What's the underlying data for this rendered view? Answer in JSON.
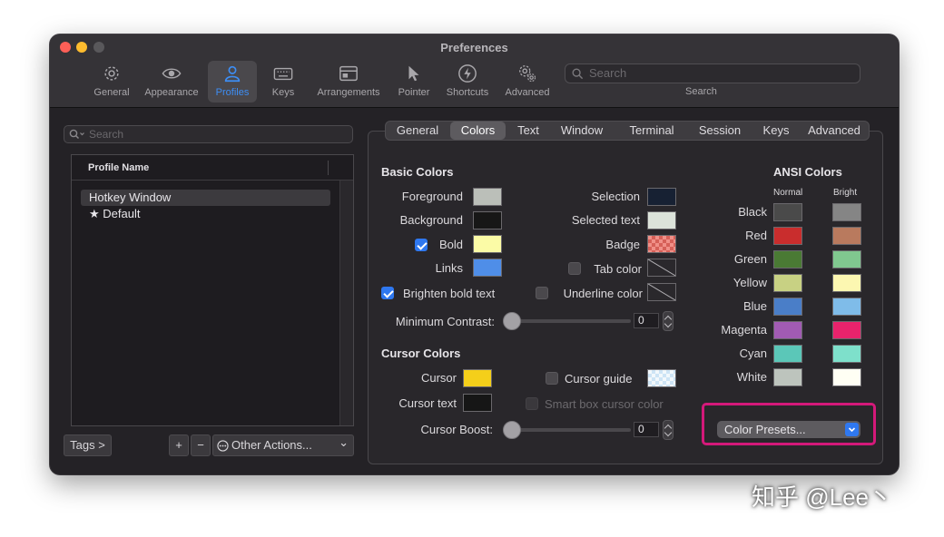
{
  "window": {
    "title": "Preferences"
  },
  "toolbar": {
    "items": [
      {
        "label": "General",
        "icon": "gear-icon"
      },
      {
        "label": "Appearance",
        "icon": "eye-icon"
      },
      {
        "label": "Profiles",
        "icon": "person-icon",
        "active": true
      },
      {
        "label": "Keys",
        "icon": "keyboard-icon"
      },
      {
        "label": "Arrangements",
        "icon": "window-icon"
      },
      {
        "label": "Pointer",
        "icon": "cursor-icon"
      },
      {
        "label": "Shortcuts",
        "icon": "lightning-icon"
      },
      {
        "label": "Advanced",
        "icon": "gears-icon"
      }
    ],
    "search_placeholder": "Search",
    "search_label": "Search"
  },
  "profiles": {
    "search_placeholder": "Search",
    "column_header": "Profile Name",
    "rows": [
      {
        "name": "Hotkey Window",
        "selected": true
      },
      {
        "name": "★ Default",
        "selected": false
      }
    ],
    "tags_button": "Tags >",
    "add_button": "+",
    "remove_button": "−",
    "other_actions": "Other Actions...",
    "other_actions_chevron": "⌄"
  },
  "tabs": [
    "General",
    "Colors",
    "Text",
    "Window",
    "Terminal",
    "Session",
    "Keys",
    "Advanced"
  ],
  "active_tab": "Colors",
  "basic_colors": {
    "heading": "Basic Colors",
    "foreground": {
      "label": "Foreground",
      "color": "#bbbfb9"
    },
    "background": {
      "label": "Background",
      "color": "#171717"
    },
    "bold": {
      "label": "Bold",
      "checked": true,
      "color": "#fbfba6"
    },
    "links": {
      "label": "Links",
      "color": "#4f8ee8"
    },
    "brighten_bold": {
      "label": "Brighten bold text",
      "checked": true
    },
    "selection": {
      "label": "Selection",
      "color": "#172133"
    },
    "selected_text": {
      "label": "Selected text",
      "color": "#dce3da"
    },
    "badge": {
      "label": "Badge",
      "color": "#e4736c"
    },
    "tab_color": {
      "label": "Tab color",
      "checked": false
    },
    "underline_color": {
      "label": "Underline color",
      "checked": false
    },
    "min_contrast": {
      "label": "Minimum Contrast:",
      "value": "0"
    }
  },
  "cursor_colors": {
    "heading": "Cursor Colors",
    "cursor": {
      "label": "Cursor",
      "color": "#f4cf1a"
    },
    "cursor_text": {
      "label": "Cursor text",
      "color": "#161616"
    },
    "cursor_guide": {
      "label": "Cursor guide",
      "checked": false
    },
    "smart_box": {
      "label": "Smart box cursor color",
      "checked": false,
      "disabled": true
    },
    "cursor_boost": {
      "label": "Cursor Boost:",
      "value": "0"
    }
  },
  "ansi": {
    "heading": "ANSI Colors",
    "normal_header": "Normal",
    "bright_header": "Bright",
    "rows": [
      {
        "name": "Black",
        "normal": "#4a4a4a",
        "bright": "#858585"
      },
      {
        "name": "Red",
        "normal": "#c92d2d",
        "bright": "#b97a5e"
      },
      {
        "name": "Green",
        "normal": "#4a7a34",
        "bright": "#80c88f"
      },
      {
        "name": "Yellow",
        "normal": "#c8d183",
        "bright": "#fcf7b1"
      },
      {
        "name": "Blue",
        "normal": "#4a7ec8",
        "bright": "#7fbce9"
      },
      {
        "name": "Magenta",
        "normal": "#a15bb3",
        "bright": "#e8236c"
      },
      {
        "name": "Cyan",
        "normal": "#5bc7b8",
        "bright": "#7ee0cb"
      },
      {
        "name": "White",
        "normal": "#bdc4bd",
        "bright": "#fffff4"
      }
    ]
  },
  "color_presets": {
    "label": "Color Presets...",
    "chevron": "⌄"
  },
  "watermark": "知乎 @Lee丶"
}
